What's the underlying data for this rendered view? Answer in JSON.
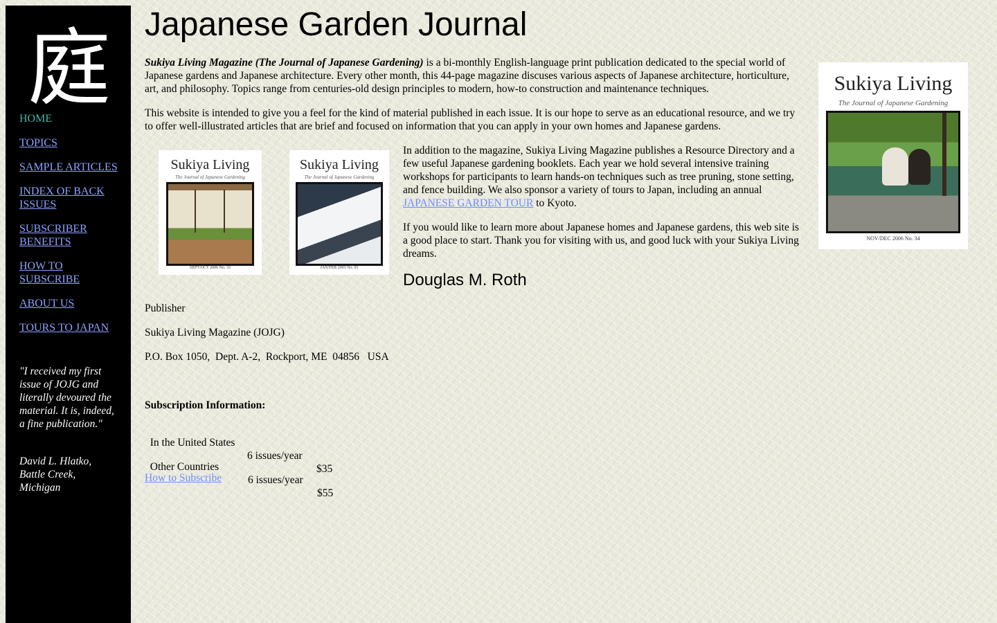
{
  "sidebar": {
    "logo_glyph": "庭",
    "nav": [
      {
        "label": "HOME",
        "active": true
      },
      {
        "label": "TOPICS"
      },
      {
        "label": "SAMPLE ARTICLES"
      },
      {
        "label": "INDEX OF BACK ISSUES"
      },
      {
        "label": "SUBSCRIBER BENEFITS"
      },
      {
        "label": "HOW TO SUBSCRIBE"
      },
      {
        "label": "ABOUT US"
      },
      {
        "label": "TOURS TO JAPAN"
      }
    ],
    "quote": "\"I received my first issue of JOJG and literally devoured the material.  It is, indeed, a fine publication.\"",
    "quote_author": "David L. Hlatko, Battle Creek, Michigan"
  },
  "main": {
    "title": "Japanese Garden Journal",
    "intro_bold": "Sukiya Living Magazine (The Journal of Japanese Gardening)",
    "intro_rest": " is a bi-monthly English-language print publication dedicated to the special world of Japanese gardens and Japanese architecture.  Every other month, this 44-page magazine discuses various aspects of Japanese architecture, horticulture, art, and philosophy.  Topics range from centuries-old design principles to modern, how-to construction and maintenance techniques.",
    "para2": "This website is intended to give you a feel for the kind of material published in each issue.  It is our hope to serve as an educational resource, and we try to offer well-illustrated articles that are brief and focused on information that you can apply in your own homes and Japanese gardens.",
    "para3_before": "In addition to the magazine, Sukiya Living Magazine publishes a Resource Directory and a few useful Japanese gardening booklets.  Each year we hold several intensive training workshops for participants to learn hands-on techniques such as tree pruning, stone setting, and fence building.  We also sponsor a variety of tours to Japan, including an annual ",
    "para3_link": "JAPANESE GARDEN TOUR",
    "para3_after": " to Kyoto.",
    "para4": "If you would like to learn more about Japanese homes and Japanese gardens, this web site is a good place to start.  Thank you for visiting with us, and good luck with your Sukiya Living dreams.",
    "signature": "Douglas M. Roth",
    "publisher_role": "Publisher",
    "publisher_name": "Sukiya Living Magazine (JOJG)",
    "address": "P.O. Box 1050,  Dept. A-2,  Rockport, ME  04856   USA",
    "subscription_heading": "Subscription Information:",
    "rates": [
      {
        "region": "In the United States",
        "issues": "6 issues/year",
        "price": "$35"
      },
      {
        "region": "Other Countries",
        "issues": "6 issues/year",
        "price": "$55"
      }
    ],
    "subscribe_link": "How to Subscribe"
  },
  "covers": {
    "title": "Sukiya Living",
    "subtitle": "The Journal of Japanese Gardening",
    "left_caption": "SEPT/OCT 2006  No. 33",
    "middle_caption": "JAN/FEB 2003  No. 01",
    "right_caption": "NOV/DEC 2006  No. 34"
  },
  "colors": {
    "link": "#6e8cff",
    "nav_link": "#8ea1ff",
    "nav_active": "#44b5aa",
    "sidebar_bg": "#000000"
  }
}
